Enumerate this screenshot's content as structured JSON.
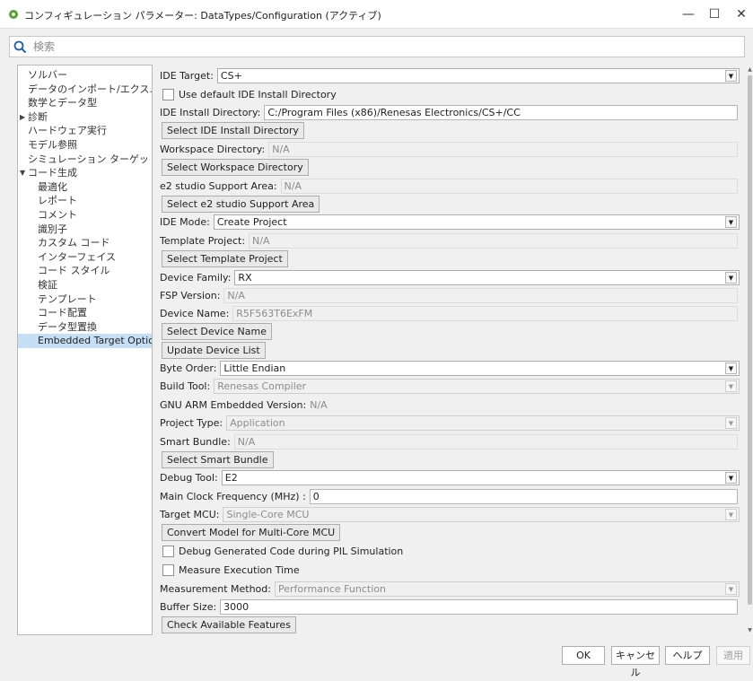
{
  "window": {
    "title": "コンフィギュレーション パラメーター: DataTypes/Configuration (アクティブ)",
    "minimize": "—",
    "maximize": "☐",
    "close": "✕"
  },
  "search": {
    "placeholder": "検索"
  },
  "tree": [
    {
      "label": "ソルバー"
    },
    {
      "label": "データのインポート/エクス..."
    },
    {
      "label": "数学とデータ型"
    },
    {
      "label": "診断",
      "expander": "▶"
    },
    {
      "label": "ハードウェア実行"
    },
    {
      "label": "モデル参照"
    },
    {
      "label": "シミュレーション ターゲット"
    },
    {
      "label": "コード生成",
      "expander": "▼"
    },
    {
      "label": "最適化"
    },
    {
      "label": "レポート"
    },
    {
      "label": "コメント"
    },
    {
      "label": "識別子"
    },
    {
      "label": "カスタム コード"
    },
    {
      "label": "インターフェイス"
    },
    {
      "label": "コード スタイル"
    },
    {
      "label": "検証"
    },
    {
      "label": "テンプレート"
    },
    {
      "label": "コード配置"
    },
    {
      "label": "データ型置換"
    },
    {
      "label": "Embedded Target Options",
      "selected": true
    }
  ],
  "form": {
    "ide_target": {
      "label": "IDE Target:",
      "value": "CS+"
    },
    "use_default_ide": {
      "label": "Use default IDE Install Directory",
      "checked": false
    },
    "ide_install_dir": {
      "label": "IDE Install Directory:",
      "value": "C:/Program Files (x86)/Renesas Electronics/CS+/CC"
    },
    "select_ide_dir_btn": "Select IDE Install Directory",
    "workspace_dir": {
      "label": "Workspace Directory:",
      "value": "N/A"
    },
    "select_workspace_btn": "Select Workspace Directory",
    "e2_support_area": {
      "label": "e2 studio Support Area:",
      "value": "N/A"
    },
    "select_e2_btn": "Select e2 studio Support Area",
    "ide_mode": {
      "label": "IDE Mode:",
      "value": "Create Project"
    },
    "template_project": {
      "label": "Template Project:",
      "value": "N/A"
    },
    "select_template_btn": "Select Template Project",
    "device_family": {
      "label": "Device Family:",
      "value": "RX"
    },
    "fsp_version": {
      "label": "FSP Version:",
      "value": "N/A"
    },
    "device_name": {
      "label": "Device Name:",
      "value": "R5F563T6ExFM"
    },
    "select_device_btn": "Select Device Name",
    "update_device_btn": "Update Device List",
    "byte_order": {
      "label": "Byte Order:",
      "value": "Little Endian"
    },
    "build_tool": {
      "label": "Build Tool:",
      "value": "Renesas Compiler"
    },
    "gnu_arm": {
      "label": "GNU ARM Embedded Version:",
      "value": "N/A"
    },
    "project_type": {
      "label": "Project Type:",
      "value": "Application"
    },
    "smart_bundle": {
      "label": "Smart Bundle:",
      "value": "N/A"
    },
    "select_smart_bundle_btn": "Select Smart Bundle",
    "debug_tool": {
      "label": "Debug Tool:",
      "value": "E2"
    },
    "main_clock": {
      "label": "Main Clock Frequency (MHz) :",
      "value": "0"
    },
    "target_mcu": {
      "label": "Target MCU:",
      "value": "Single-Core MCU"
    },
    "convert_model_btn": "Convert Model for Multi-Core MCU",
    "debug_pil": {
      "label": "Debug Generated Code during PIL Simulation",
      "checked": false
    },
    "measure_exec": {
      "label": "Measure Execution Time",
      "checked": false
    },
    "measurement_method": {
      "label": "Measurement Method:",
      "value": "Performance Function"
    },
    "buffer_size": {
      "label": "Buffer Size:",
      "value": "3000"
    },
    "check_features_btn": "Check Available Features"
  },
  "footer": {
    "ok": "OK",
    "cancel": "キャンセル",
    "help": "ヘルプ",
    "apply": "適用"
  },
  "colors": {
    "selected_tree_bg": "#c7dff5",
    "panel_bg": "#f0f0f0",
    "app_icon": "#5a9e3a"
  }
}
